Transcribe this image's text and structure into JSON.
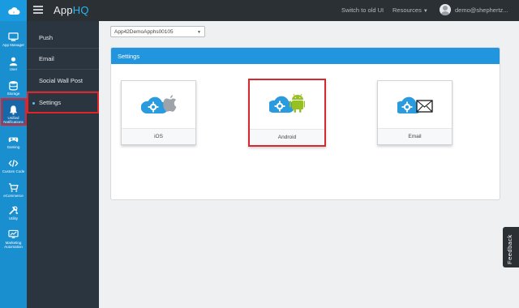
{
  "brand": {
    "prefix": "App",
    "accent": "HQ"
  },
  "topbar": {
    "switch_label": "Switch to old UI",
    "resources_label": "Resources",
    "user_email": "demo@shephertz...",
    "logo_icon": "cloud-icon"
  },
  "rail": {
    "items": [
      {
        "label": "App Manager",
        "icon": "app-manager-icon"
      },
      {
        "label": "User",
        "icon": "user-icon"
      },
      {
        "label": "Storage",
        "icon": "storage-icon"
      },
      {
        "label": "Unified Notifications",
        "icon": "bell-icon",
        "active": true
      },
      {
        "label": "Gaming",
        "icon": "gamepad-icon"
      },
      {
        "label": "Custom Code",
        "icon": "code-icon"
      },
      {
        "label": "eCommerce",
        "icon": "cart-icon"
      },
      {
        "label": "Utility",
        "icon": "tools-icon"
      },
      {
        "label": "Marketing Automation",
        "icon": "marketing-icon"
      }
    ]
  },
  "subnav": {
    "items": [
      {
        "label": "Push"
      },
      {
        "label": "Email"
      },
      {
        "label": "Social Wall Post"
      },
      {
        "label": "Settings",
        "active": true
      }
    ]
  },
  "app_select": {
    "value": "App42DemoApphs00105"
  },
  "panel": {
    "title": "Settings",
    "cards": [
      {
        "label": "iOS",
        "icon": "apple-icon"
      },
      {
        "label": "Android",
        "icon": "android-icon",
        "highlighted": true
      },
      {
        "label": "Email",
        "icon": "envelope-icon"
      }
    ]
  },
  "feedback_label": "Feedback",
  "colors": {
    "topbar": "#2b3035",
    "rail": "#1a8fd0",
    "subnav": "#2a3540",
    "panel_header": "#2195dd",
    "highlight": "#e0242a",
    "android_green": "#97c024"
  }
}
